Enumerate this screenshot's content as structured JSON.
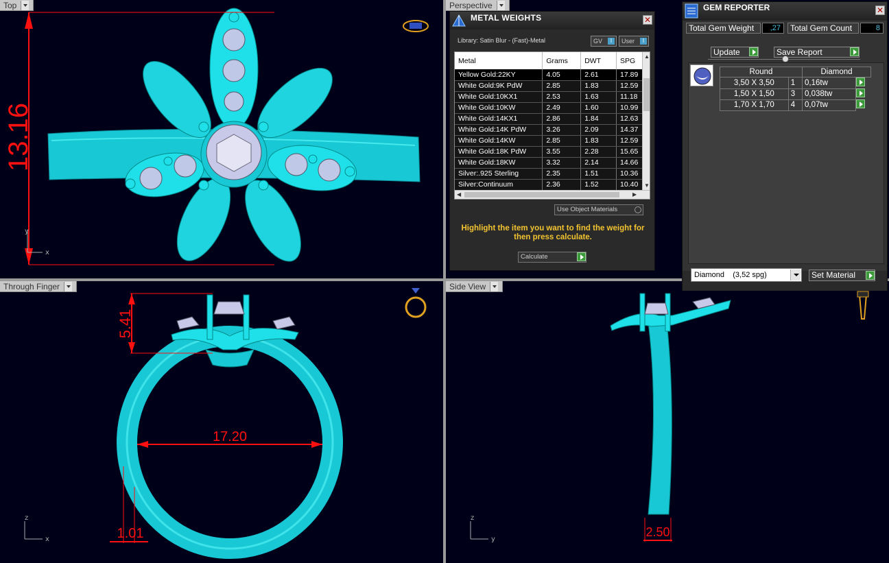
{
  "viewports": {
    "top": {
      "label": "Top"
    },
    "perspective": {
      "label": "Perspective"
    },
    "through_finger": {
      "label": "Through Finger"
    },
    "side_view": {
      "label": "Side View"
    }
  },
  "dimensions": {
    "top_height": "13.16",
    "front_top_height": "5.41",
    "front_inner_diameter": "17.20",
    "front_band_width": "1.01",
    "side_band_width": "2.50"
  },
  "axes": {
    "top": {
      "v": "y",
      "h": "x"
    },
    "front": {
      "v": "z",
      "h": "x"
    },
    "side": {
      "v": "z",
      "h": "y"
    }
  },
  "colors": {
    "model": "#1fe0e8",
    "dimension": "#ff1010",
    "viewport_bg": "#000018",
    "highlight_text": "#f4c430"
  },
  "metal_weights": {
    "title": "METAL WEIGHTS",
    "library": "Library: Satin Blur - (Fast)-Metal",
    "toggle_gv": "GV",
    "toggle_user": "User",
    "columns": [
      "Metal",
      "Grams",
      "DWT",
      "SPG"
    ],
    "rows": [
      [
        "Yellow Gold:22KY",
        "4.05",
        "2.61",
        "17.89"
      ],
      [
        "White Gold:9K PdW",
        "2.85",
        "1.83",
        "12.59"
      ],
      [
        "White Gold:10KX1",
        "2.53",
        "1.63",
        "11.18"
      ],
      [
        "White Gold:10KW",
        "2.49",
        "1.60",
        "10.99"
      ],
      [
        "White Gold:14KX1",
        "2.86",
        "1.84",
        "12.63"
      ],
      [
        "White Gold:14K PdW",
        "3.26",
        "2.09",
        "14.37"
      ],
      [
        "White Gold:14KW",
        "2.85",
        "1.83",
        "12.59"
      ],
      [
        "White Gold:18K PdW",
        "3.55",
        "2.28",
        "15.65"
      ],
      [
        "White Gold:18KW",
        "3.32",
        "2.14",
        "14.66"
      ],
      [
        "Silver:.925 Sterling",
        "2.35",
        "1.51",
        "10.36"
      ],
      [
        "Silver:Continuum",
        "2.36",
        "1.52",
        "10.40"
      ]
    ],
    "use_object_materials": "Use Object Materials",
    "hint": "Highlight the item you want to find the weight for then press calculate.",
    "calculate": "Calculate"
  },
  "gem_reporter": {
    "title": "GEM REPORTER",
    "total_weight_label": "Total Gem Weight",
    "total_weight_value": ",27",
    "total_count_label": "Total Gem Count",
    "total_count_value": "8",
    "update": "Update",
    "save_report": "Save Report",
    "columns": [
      "Round",
      "",
      "Diamond"
    ],
    "rows": [
      [
        "3,50 X 3,50",
        "1",
        "0,16tw"
      ],
      [
        "1,50 X 1,50",
        "3",
        "0,038tw"
      ],
      [
        "1,70 X 1,70",
        "4",
        "0,07tw"
      ]
    ],
    "material": "Diamond    (3,52 spg)",
    "set_material": "Set Material"
  }
}
